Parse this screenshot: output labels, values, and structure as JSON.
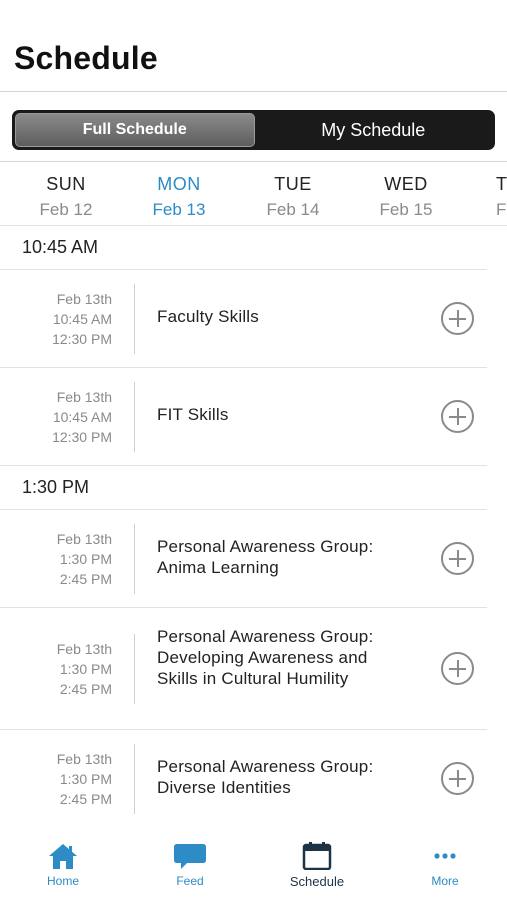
{
  "header": {
    "title": "Schedule"
  },
  "toggle": {
    "full": "Full Schedule",
    "mine": "My Schedule"
  },
  "days": [
    {
      "name": "SUN",
      "date": "Feb 12"
    },
    {
      "name": "MON",
      "date": "Feb 13"
    },
    {
      "name": "TUE",
      "date": "Feb 14"
    },
    {
      "name": "WED",
      "date": "Feb 15"
    },
    {
      "name": "T",
      "date": "Fe"
    }
  ],
  "groups": [
    {
      "time": "10:45 AM",
      "sessions": [
        {
          "date": "Feb 13th",
          "start": "10:45 AM",
          "end": "12:30 PM",
          "title": "Faculty Skills"
        },
        {
          "date": "Feb 13th",
          "start": "10:45 AM",
          "end": "12:30 PM",
          "title": "FIT Skills"
        }
      ]
    },
    {
      "time": "1:30 PM",
      "sessions": [
        {
          "date": "Feb 13th",
          "start": "1:30 PM",
          "end": "2:45 PM",
          "title": "Personal Awareness Group: Anima Learning"
        },
        {
          "date": "Feb 13th",
          "start": "1:30 PM",
          "end": "2:45 PM",
          "title": "Personal Awareness Group: Developing Awareness and Skills in Cultural Humility"
        },
        {
          "date": "Feb 13th",
          "start": "1:30 PM",
          "end": "2:45 PM",
          "title": "Personal Awareness Group: Diverse Identities"
        }
      ]
    }
  ],
  "tabbar": {
    "home": {
      "label": "Home",
      "icon": "home-icon"
    },
    "feed": {
      "label": "Feed",
      "icon": "chat-bubble-icon"
    },
    "schedule": {
      "label": "Schedule",
      "icon": "calendar-icon"
    },
    "more": {
      "label": "More",
      "icon": "more-dots-icon"
    }
  },
  "colors": {
    "accent": "#2d8bc6",
    "tab_active": "#1d3447",
    "toggle_bg": "#1a1a1a"
  }
}
